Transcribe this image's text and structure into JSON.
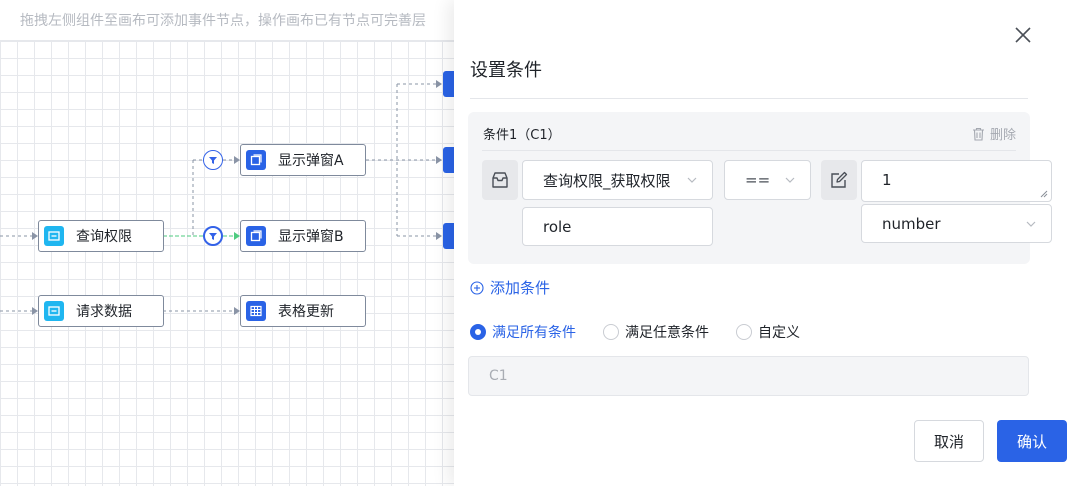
{
  "canvas": {
    "hint": "拖拽左侧组件至画布可添加事件节点，操作画布已有节点可完善层",
    "nodes": [
      {
        "label": "查询权限",
        "icon": "card-icon",
        "color": "#1fb6f0"
      },
      {
        "label": "请求数据",
        "icon": "card-icon",
        "color": "#1fb6f0"
      },
      {
        "label": "显示弹窗A",
        "icon": "window-icon",
        "color": "#2a63e6"
      },
      {
        "label": "显示弹窗B",
        "icon": "window-icon",
        "color": "#2a63e6"
      },
      {
        "label": "表格更新",
        "icon": "table-icon",
        "color": "#2a63e6"
      }
    ]
  },
  "drawer": {
    "title": "设置条件",
    "close_icon": "close-icon",
    "condition": {
      "header": "条件1（C1）",
      "delete_label": "删除",
      "source_value": "查询权限_获取权限",
      "field_value": "role",
      "operator_value": "==",
      "target_value": "1",
      "type_value": "number"
    },
    "add_condition_label": "添加条件",
    "radio_options": [
      {
        "label": "满足所有条件",
        "checked": true
      },
      {
        "label": "满足任意条件",
        "checked": false
      },
      {
        "label": "自定义",
        "checked": false
      }
    ],
    "expression_placeholder": "C1",
    "cancel_label": "取消",
    "confirm_label": "确认"
  },
  "colors": {
    "primary": "#2a63e6",
    "cyan_node": "#1fb6f0"
  }
}
